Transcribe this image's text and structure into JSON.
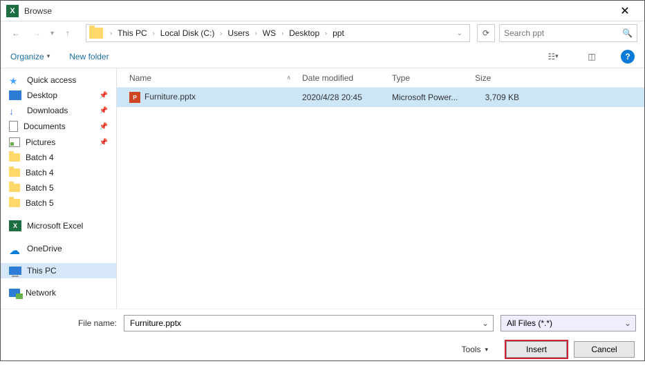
{
  "window": {
    "title": "Browse"
  },
  "nav": {
    "breadcrumb": [
      "This PC",
      "Local Disk (C:)",
      "Users",
      "WS",
      "Desktop",
      "ppt"
    ],
    "search_placeholder": "Search ppt"
  },
  "toolbar": {
    "organize": "Organize",
    "newfolder": "New folder"
  },
  "sidebar": {
    "items": [
      {
        "label": "Quick access",
        "icon": "star"
      },
      {
        "label": "Desktop",
        "icon": "desktop",
        "pin": true
      },
      {
        "label": "Downloads",
        "icon": "down",
        "pin": true
      },
      {
        "label": "Documents",
        "icon": "doc",
        "pin": true
      },
      {
        "label": "Pictures",
        "icon": "pic",
        "pin": true
      },
      {
        "label": "Batch 4",
        "icon": "folder"
      },
      {
        "label": "Batch 4",
        "icon": "folder"
      },
      {
        "label": "Batch 5",
        "icon": "folder"
      },
      {
        "label": "Batch 5",
        "icon": "folder"
      },
      {
        "gap": true
      },
      {
        "label": "Microsoft Excel",
        "icon": "excel"
      },
      {
        "gap": true
      },
      {
        "label": "OneDrive",
        "icon": "odrive"
      },
      {
        "gap": true
      },
      {
        "label": "This PC",
        "icon": "pc",
        "selected": true
      },
      {
        "gap": true
      },
      {
        "label": "Network",
        "icon": "net"
      }
    ]
  },
  "columns": {
    "name": "Name",
    "date": "Date modified",
    "type": "Type",
    "size": "Size"
  },
  "files": [
    {
      "name": "Furniture.pptx",
      "date": "2020/4/28 20:45",
      "type": "Microsoft Power...",
      "size": "3,709 KB",
      "selected": true
    }
  ],
  "bottom": {
    "filename_label": "File name:",
    "filename_value": "Furniture.pptx",
    "filetype": "All Files (*.*)",
    "tools": "Tools",
    "insert": "Insert",
    "cancel": "Cancel"
  }
}
